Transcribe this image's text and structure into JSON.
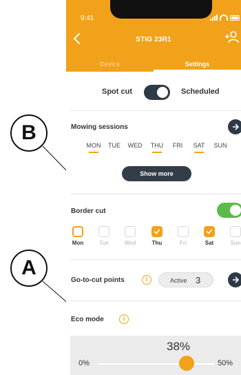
{
  "status_bar": {
    "time": "9:41"
  },
  "header": {
    "title": "STIG 23R1"
  },
  "tabs": [
    {
      "label": "Device",
      "selected": false
    },
    {
      "label": "Settings",
      "selected": true
    }
  ],
  "mode": {
    "left_label": "Spot cut",
    "right_label": "Scheduled",
    "toggle_on": true
  },
  "mowing_sessions": {
    "title": "Mowing sessions",
    "days": [
      {
        "label": "MON",
        "active": true
      },
      {
        "label": "TUE",
        "active": false
      },
      {
        "label": "WED",
        "active": false
      },
      {
        "label": "THU",
        "active": true
      },
      {
        "label": "FRI",
        "active": false
      },
      {
        "label": "SAT",
        "active": true
      },
      {
        "label": "SUN",
        "active": false
      }
    ],
    "show_more_label": "Show more"
  },
  "border_cut": {
    "title": "Border cut",
    "enabled": true,
    "days": [
      {
        "label": "Mon",
        "state": "highlighted"
      },
      {
        "label": "Tue",
        "state": "unchecked"
      },
      {
        "label": "Wed",
        "state": "unchecked"
      },
      {
        "label": "Thu",
        "state": "checked"
      },
      {
        "label": "Fri",
        "state": "unchecked"
      },
      {
        "label": "Sat",
        "state": "checked"
      },
      {
        "label": "Sun",
        "state": "unchecked"
      }
    ]
  },
  "go_to_cut": {
    "title": "Go-to-cut points",
    "info_symbol": "i",
    "pill_label": "Active",
    "pill_count": "3"
  },
  "eco_mode": {
    "title": "Eco mode",
    "info_symbol": "i",
    "value_label": "38%",
    "value_fraction": 0.38,
    "min_label": "0%",
    "max_label": "50%"
  },
  "callouts": {
    "a": "A",
    "b": "B"
  },
  "colors": {
    "accent": "#f1a21a",
    "dark": "#2e3a45",
    "green": "#5cba4a"
  },
  "icons": [
    "back-arrow-icon",
    "add-user-icon",
    "arrow-right-icon",
    "info-icon",
    "checkmark-icon"
  ]
}
